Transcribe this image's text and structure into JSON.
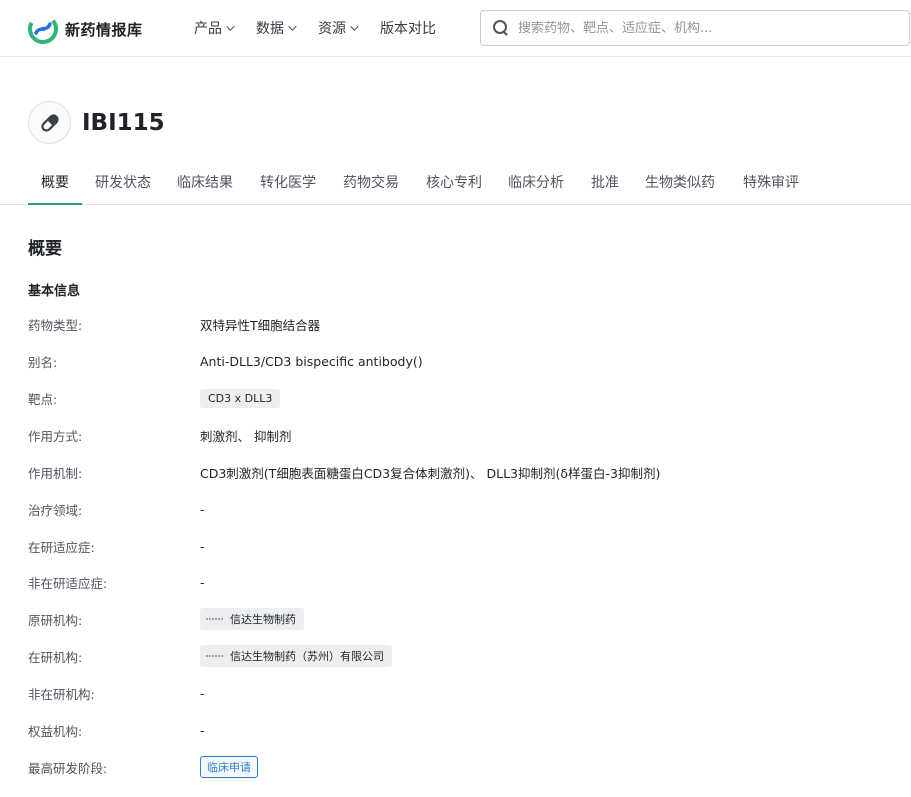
{
  "brand": {
    "name": "新药情报库"
  },
  "nav": [
    {
      "label": "产品",
      "has_menu": true
    },
    {
      "label": "数据",
      "has_menu": true
    },
    {
      "label": "资源",
      "has_menu": true
    },
    {
      "label": "版本对比",
      "has_menu": false
    }
  ],
  "search": {
    "placeholder": "搜索药物、靶点、适应症、机构..."
  },
  "drug": {
    "name": "IBI115",
    "icon": "pill-icon"
  },
  "tabs": [
    {
      "label": "概要",
      "active": true
    },
    {
      "label": "研发状态"
    },
    {
      "label": "临床结果"
    },
    {
      "label": "转化医学"
    },
    {
      "label": "药物交易"
    },
    {
      "label": "核心专利"
    },
    {
      "label": "临床分析"
    },
    {
      "label": "批准"
    },
    {
      "label": "生物类似药"
    },
    {
      "label": "特殊审评"
    }
  ],
  "section": {
    "title": "概要",
    "subtitle": "基本信息"
  },
  "fields": {
    "drug_type": {
      "label": "药物类型:",
      "value": "双特异性T细胞结合器"
    },
    "alias": {
      "label": "别名:",
      "value": "Anti-DLL3/CD3 bispecific antibody()"
    },
    "target": {
      "label": "靶点:",
      "value": "CD3 x DLL3"
    },
    "action_mode": {
      "label": "作用方式:",
      "value": "刺激剂、 抑制剂"
    },
    "mechanism": {
      "label": "作用机制:",
      "value": "CD3刺激剂(T细胞表面糖蛋白CD3复合体刺激剂)、 DLL3抑制剂(δ样蛋白-3抑制剂)"
    },
    "therapeutic_area": {
      "label": "治疗领域:",
      "value": "-"
    },
    "active_indication": {
      "label": "在研适应症:",
      "value": "-"
    },
    "inactive_indication": {
      "label": "非在研适应症:",
      "value": "-"
    },
    "originator": {
      "label": "原研机构:",
      "value": "信达生物制药"
    },
    "active_org": {
      "label": "在研机构:",
      "value": "信达生物制药（苏州）有限公司"
    },
    "inactive_org": {
      "label": "非在研机构:",
      "value": "-"
    },
    "rights_org": {
      "label": "权益机构:",
      "value": "-"
    },
    "highest_phase": {
      "label": "最高研发阶段:",
      "value": "临床申请"
    }
  },
  "colors": {
    "accent": "#2a9d8f",
    "stage": "#2f7fd0",
    "logo_green": "#2bb673",
    "logo_blue": "#2a6fdb"
  }
}
